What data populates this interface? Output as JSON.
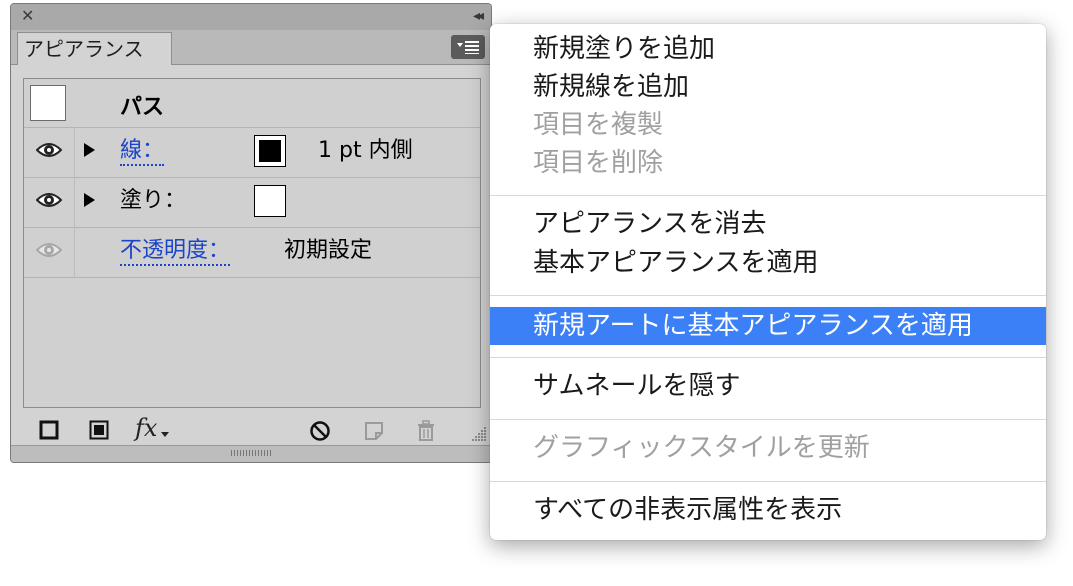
{
  "panel": {
    "tab_label": "アピアランス",
    "close_glyph": "✕",
    "collapse_glyph": "◂◂",
    "rows": {
      "object": {
        "label": "パス"
      },
      "stroke": {
        "label": "線：",
        "value": "1 pt  内側",
        "swatch_color": "#000000"
      },
      "fill": {
        "label": "塗り：",
        "swatch_color": "#ffffff"
      },
      "opacity": {
        "label": "不透明度：",
        "value": "初期設定"
      }
    },
    "footer_icons": [
      "add-stroke-icon",
      "add-fill-icon",
      "fx-icon",
      "clear-icon",
      "duplicate-icon",
      "delete-icon"
    ],
    "fx_label": "fx"
  },
  "menu": {
    "items": [
      {
        "label": "新規塗りを追加",
        "enabled": true,
        "selected": false
      },
      {
        "label": "新規線を追加",
        "enabled": true,
        "selected": false
      },
      {
        "label": "項目を複製",
        "enabled": false,
        "selected": false
      },
      {
        "label": "項目を削除",
        "enabled": false,
        "selected": false
      },
      {
        "label": "アピアランスを消去",
        "enabled": true,
        "selected": false
      },
      {
        "label": "基本アピアランスを適用",
        "enabled": true,
        "selected": false
      },
      {
        "label": "新規アートに基本アピアランスを適用",
        "enabled": true,
        "selected": true
      },
      {
        "label": "サムネールを隠す",
        "enabled": true,
        "selected": false
      },
      {
        "label": "グラフィックスタイルを更新",
        "enabled": false,
        "selected": false
      },
      {
        "label": "すべての非表示属性を表示",
        "enabled": true,
        "selected": false
      }
    ]
  },
  "colors": {
    "link_blue": "#1a44c9",
    "selection_blue": "#3b80f6",
    "disabled_text": "#a0a0a0"
  }
}
